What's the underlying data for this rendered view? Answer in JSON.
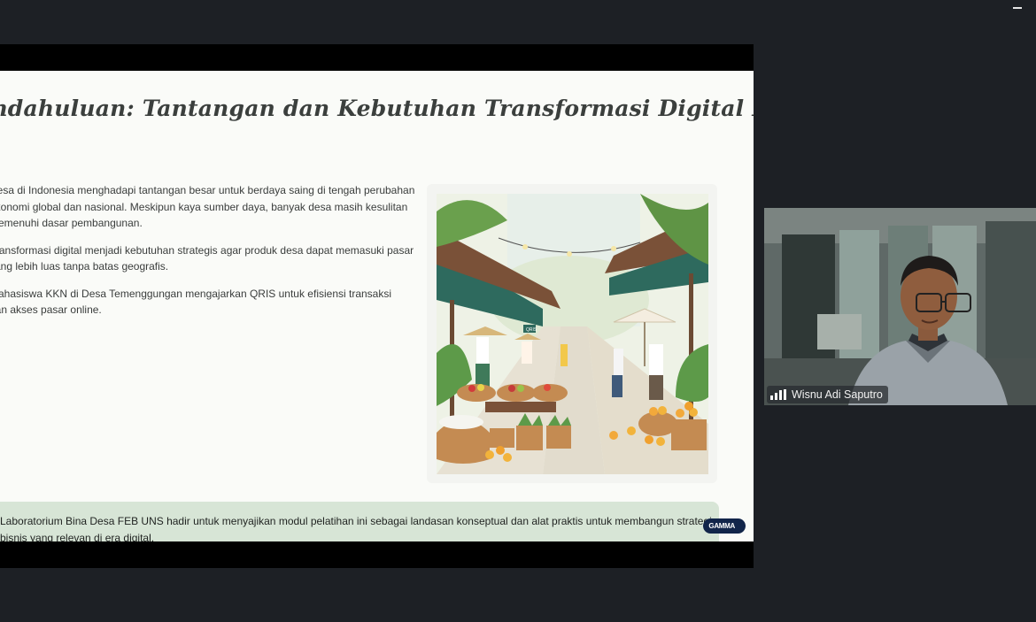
{
  "window": {
    "minimize_label": "minimize"
  },
  "slide": {
    "title": "Pendahuluan: Tantangan dan Kebutuhan Transformasi Digital Desa",
    "bullets": [
      {
        "lines": [
          "Desa di Indonesia menghadapi tantangan besar untuk berdaya saing di tengah perubahan",
          "ekonomi global dan nasional. Meskipun kaya sumber daya, banyak desa masih kesulitan",
          "memenuhi dasar pembangunan."
        ]
      },
      {
        "lines": [
          "Transformasi digital menjadi kebutuhan strategis agar produk desa dapat memasuki pasar",
          "yang lebih luas tanpa batas geografis."
        ]
      },
      {
        "lines": [
          "Mahasiswa KKN di Desa Temenggungan mengajarkan QRIS untuk efisiensi transaksi",
          "dan akses pasar online."
        ]
      }
    ],
    "callout": {
      "lines": [
        "Laboratorium Bina Desa FEB UNS hadir untuk menyajikan modul pelatihan ini sebagai landasan konseptual dan alat praktis untuk membangun strategi",
        "bisnis yang relevan di era digital."
      ]
    },
    "logo_text": "GAMMA",
    "illustration": {
      "icon": "village-market-illustration",
      "sign_text": "QRIS"
    }
  },
  "participant": {
    "name": "Wisnu Adi Saputro",
    "signal_icon": "signal-bars-icon"
  },
  "colors": {
    "background": "#1d2025",
    "slide_bg": "#fafbf8",
    "callout_bg": "#d7e5d6",
    "title_color": "#3b3f3d",
    "logo_pill": "#12254a"
  }
}
